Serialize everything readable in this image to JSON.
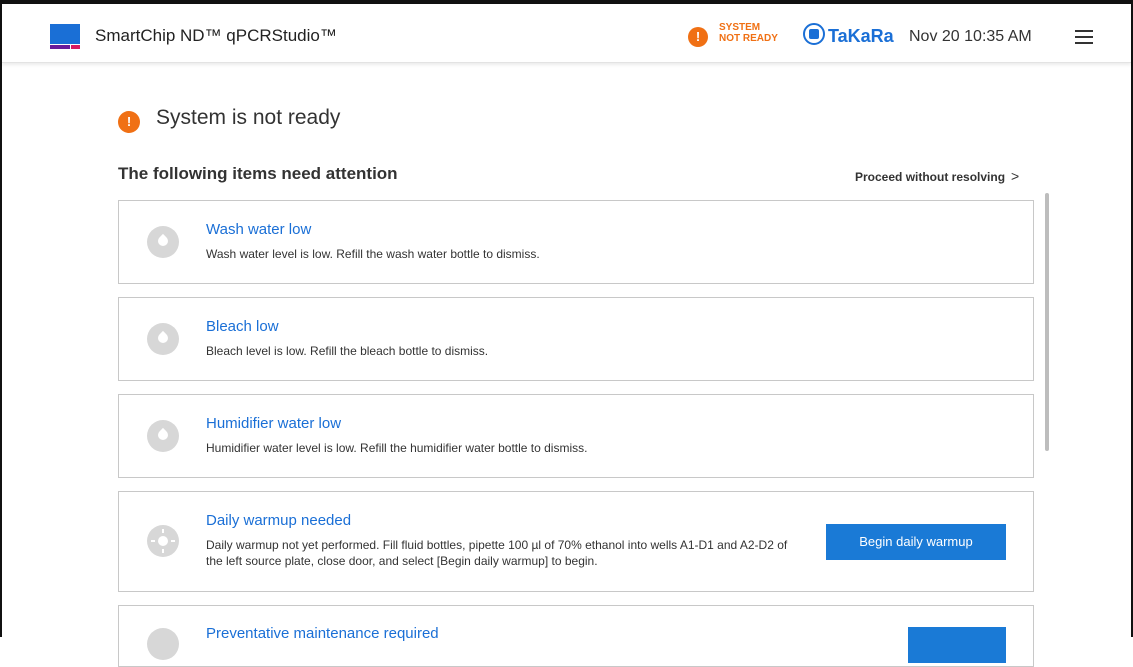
{
  "header": {
    "app_title": "SmartChip ND™ qPCRStudio™",
    "status_line1": "SYSTEM",
    "status_line2": "NOT READY",
    "brand": "TaKaRa",
    "datetime": "Nov 20 10:35 AM",
    "alert_symbol": "!"
  },
  "main": {
    "alert_symbol": "!",
    "page_title": "System is not ready",
    "section_title": "The following items need attention",
    "proceed_label": "Proceed without resolving",
    "proceed_chevron": ">"
  },
  "items": [
    {
      "icon": "water-drop-icon",
      "title": "Wash water low",
      "description": "Wash water level is low. Refill the wash water bottle to dismiss."
    },
    {
      "icon": "water-drop-icon",
      "title": "Bleach low",
      "description": "Bleach level is low. Refill the bleach bottle to dismiss."
    },
    {
      "icon": "water-drop-icon",
      "title": "Humidifier water low",
      "description": "Humidifier water level is low. Refill the humidifier water bottle to dismiss."
    },
    {
      "icon": "sun-icon",
      "title": "Daily warmup needed",
      "description": "Daily warmup not yet performed. Fill fluid bottles, pipette 100 µl of 70% ethanol into wells A1-D1 and A2-D2 of the left source plate, close door, and select [Begin daily warmup] to begin.",
      "button": "Begin daily warmup"
    },
    {
      "icon": "maintenance-icon",
      "title": "Preventative maintenance required",
      "description": ""
    }
  ],
  "colors": {
    "accent": "#1a6fd6",
    "warning": "#f07014",
    "button": "#1a7ad6",
    "icon_bg": "#d7d7d7"
  }
}
